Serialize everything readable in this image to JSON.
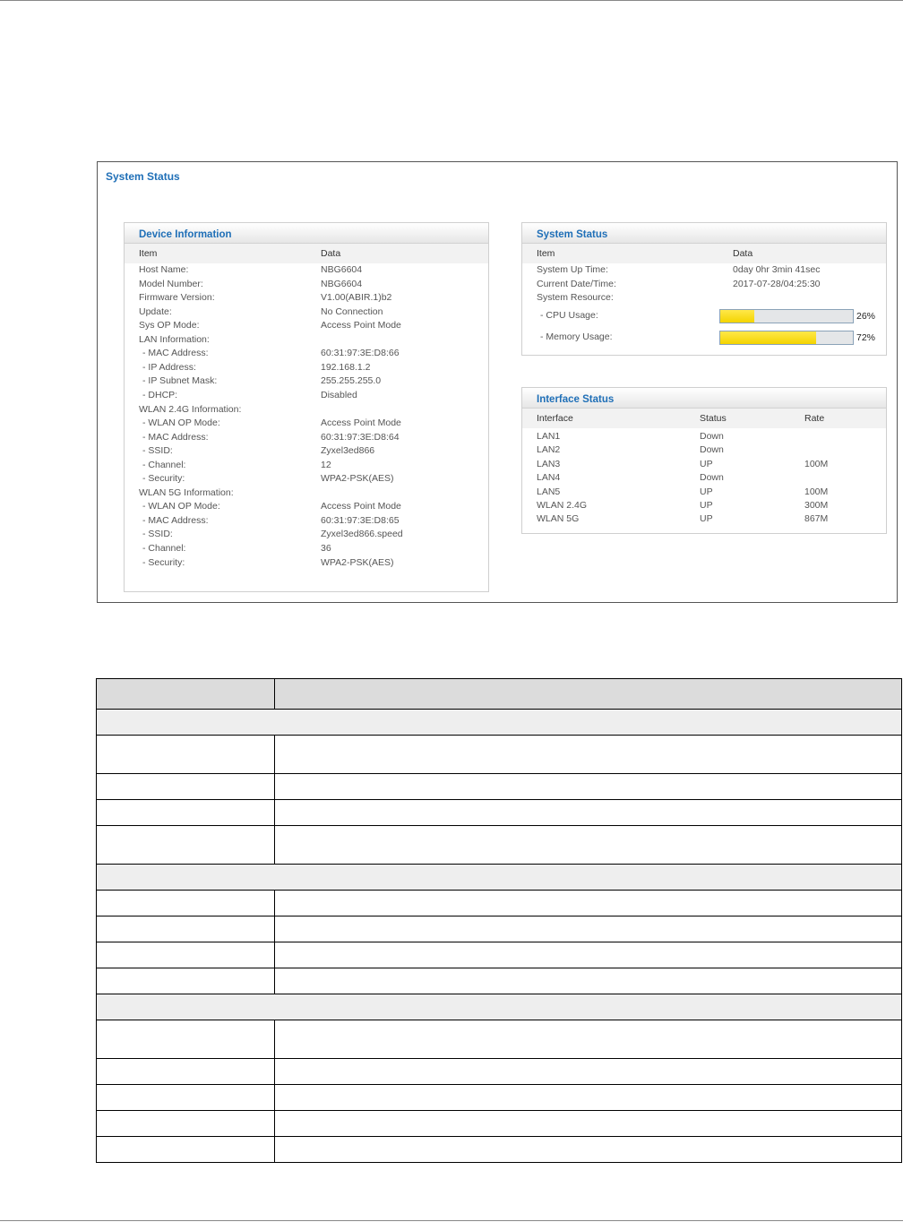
{
  "screen_title": "System Status",
  "device_info": {
    "title": "Device Information",
    "col_item": "Item",
    "col_data": "Data",
    "rows": [
      {
        "item": "Host Name:",
        "data": "NBG6604"
      },
      {
        "item": "Model Number:",
        "data": "NBG6604"
      },
      {
        "item": "Firmware Version:",
        "data": "V1.00(ABIR.1)b2"
      },
      {
        "item": "Update:",
        "data": "No Connection"
      },
      {
        "item": "Sys OP Mode:",
        "data": "Access Point Mode"
      },
      {
        "item": "LAN Information:",
        "data": ""
      },
      {
        "item": "- MAC Address:",
        "data": "60:31:97:3E:D8:66"
      },
      {
        "item": "- IP Address:",
        "data": "192.168.1.2"
      },
      {
        "item": "- IP Subnet Mask:",
        "data": "255.255.255.0"
      },
      {
        "item": "- DHCP:",
        "data": "Disabled"
      },
      {
        "item": "WLAN 2.4G Information:",
        "data": ""
      },
      {
        "item": "- WLAN OP Mode:",
        "data": "Access Point Mode"
      },
      {
        "item": "- MAC Address:",
        "data": "60:31:97:3E:D8:64"
      },
      {
        "item": "- SSID:",
        "data": "Zyxel3ed866"
      },
      {
        "item": "- Channel:",
        "data": "12"
      },
      {
        "item": "- Security:",
        "data": "WPA2-PSK(AES)"
      },
      {
        "item": "WLAN 5G Information:",
        "data": ""
      },
      {
        "item": "- WLAN OP Mode:",
        "data": "Access Point Mode"
      },
      {
        "item": "- MAC Address:",
        "data": "60:31:97:3E:D8:65"
      },
      {
        "item": "- SSID:",
        "data": "Zyxel3ed866.speed"
      },
      {
        "item": "- Channel:",
        "data": "36"
      },
      {
        "item": "- Security:",
        "data": "WPA2-PSK(AES)"
      }
    ]
  },
  "system_status": {
    "title": "System Status",
    "col_item": "Item",
    "col_data": "Data",
    "uptime_label": "System Up Time:",
    "uptime_value": "0day 0hr 3min 41sec",
    "datetime_label": "Current Date/Time:",
    "datetime_value": "2017-07-28/04:25:30",
    "resource_label": "System Resource:",
    "cpu_label": "- CPU Usage:",
    "cpu_percent": "26%",
    "cpu_level": 0.26,
    "memory_label": "- Memory Usage:",
    "memory_percent": "72%",
    "memory_level": 0.72
  },
  "interface_status": {
    "title": "Interface Status",
    "col_interface": "Interface",
    "col_status": "Status",
    "col_rate": "Rate",
    "rows": [
      {
        "interface": "LAN1",
        "status": "Down",
        "rate": ""
      },
      {
        "interface": "LAN2",
        "status": "Down",
        "rate": ""
      },
      {
        "interface": "LAN3",
        "status": "UP",
        "rate": "100M"
      },
      {
        "interface": "LAN4",
        "status": "Down",
        "rate": ""
      },
      {
        "interface": "LAN5",
        "status": "UP",
        "rate": "100M"
      },
      {
        "interface": "WLAN 2.4G",
        "status": "UP",
        "rate": "300M"
      },
      {
        "interface": "WLAN 5G",
        "status": "UP",
        "rate": "867M"
      }
    ]
  },
  "colors": {
    "title_blue": "#1f6fb7",
    "bar_yellow": "#f4d400"
  }
}
